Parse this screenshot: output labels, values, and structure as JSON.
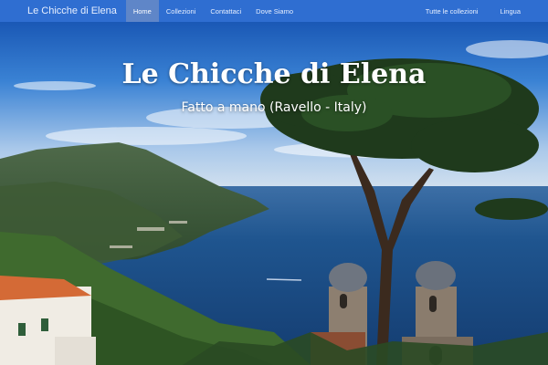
{
  "nav": {
    "brand": "Le Chicche di Elena",
    "items": [
      {
        "label": "Home",
        "active": true
      },
      {
        "label": "Collezioni",
        "active": false
      },
      {
        "label": "Contattaci",
        "active": false
      },
      {
        "label": "Dove Siamo",
        "active": false
      }
    ],
    "right_items": [
      {
        "label": "Tutte le collezioni"
      },
      {
        "label": "Lingua"
      }
    ]
  },
  "hero": {
    "title": "Le Chicche di Elena",
    "subtitle": "Fatto a mano (Ravello - Italy)"
  },
  "colors": {
    "navbar": "#2f6ed1",
    "active_tab": "#5f86c8",
    "sea": "#1d4c88",
    "sky": "#3e86d6"
  }
}
